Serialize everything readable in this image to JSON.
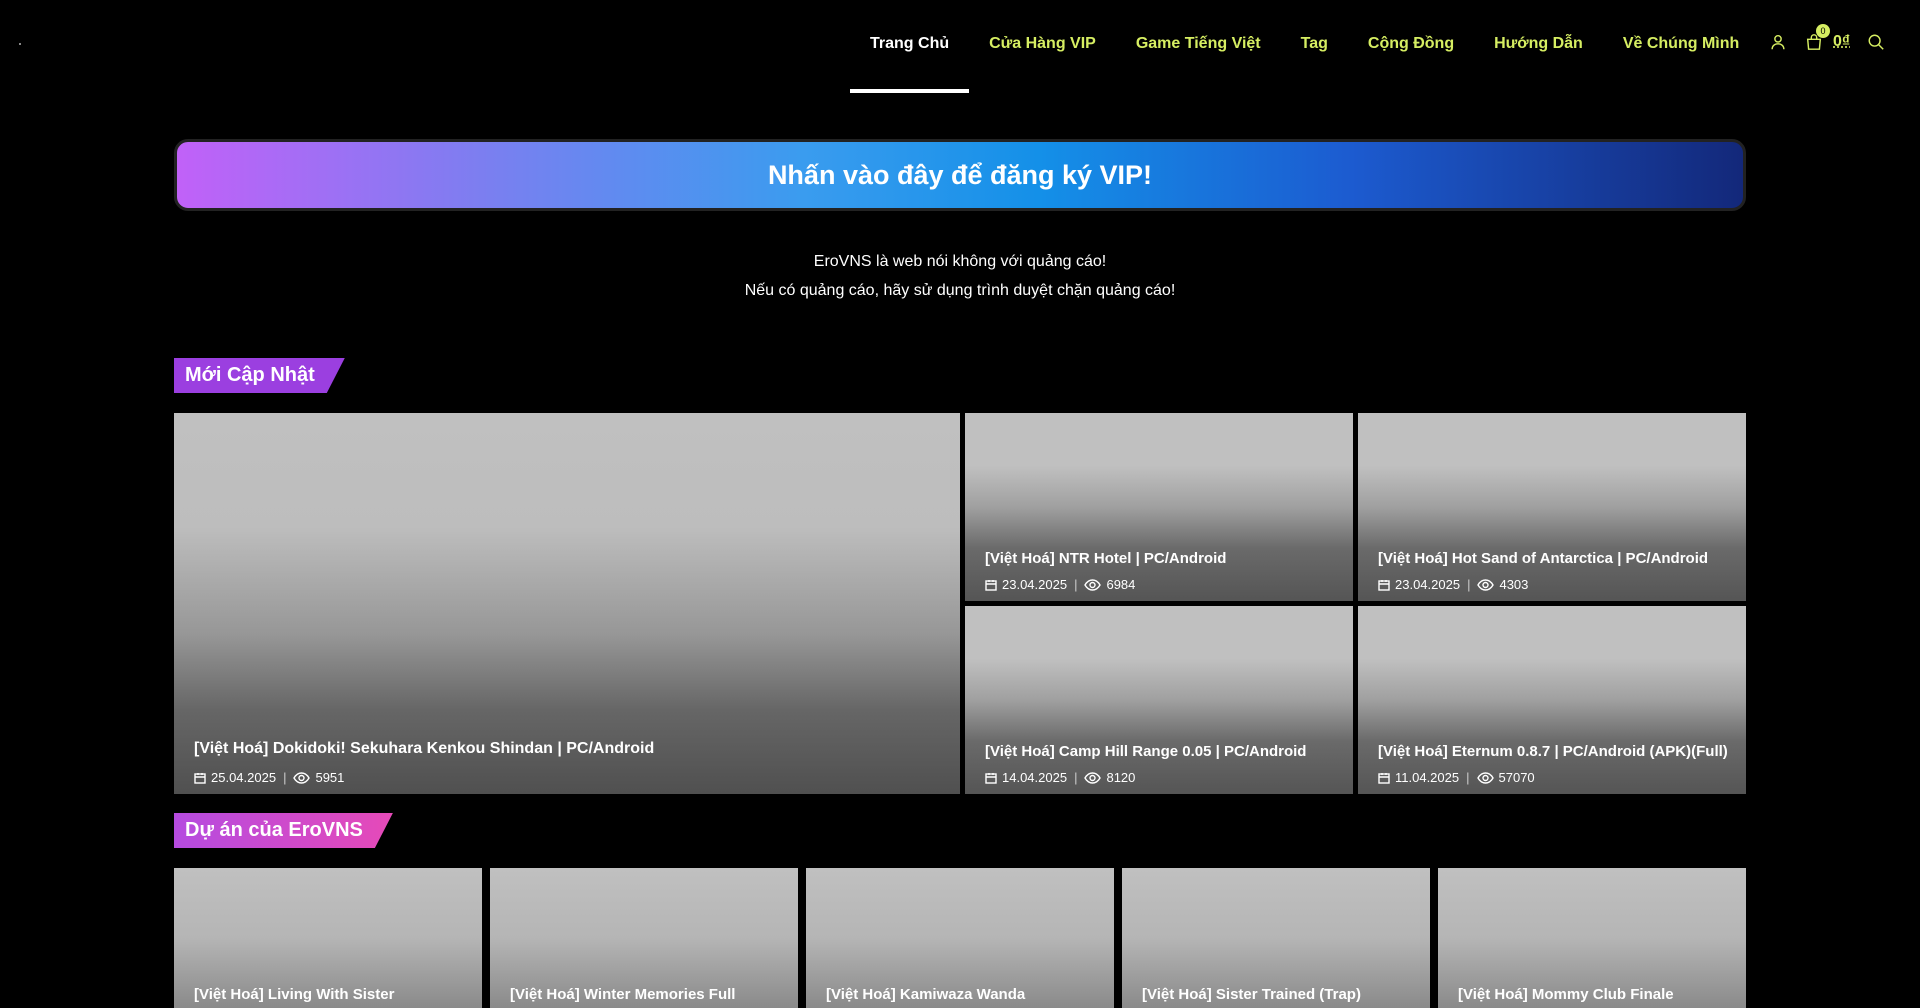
{
  "nav": {
    "items": [
      {
        "label": "Trang Chủ",
        "active": true
      },
      {
        "label": "Cửa Hàng VIP"
      },
      {
        "label": "Game Tiếng Việt"
      },
      {
        "label": "Tag"
      },
      {
        "label": "Cộng Đồng"
      },
      {
        "label": "Hướng Dẫn"
      },
      {
        "label": "Về Chúng Mình"
      }
    ],
    "cart_count": "0",
    "cart_total": "0₫"
  },
  "banner": {
    "text": "Nhấn vào đây để đăng ký VIP!"
  },
  "notice": {
    "line1": "EroVNS là web nói không với quảng cáo!",
    "line2": "Nếu có quảng cáo, hãy sử dụng trình duyệt chặn quảng cáo!"
  },
  "latest": {
    "title": "Mới Cập Nhật",
    "posts": [
      {
        "title": "[Việt Hoá] Dokidoki! Sekuhara Kenkou Shindan | PC/Android",
        "date": "25.04.2025",
        "views": "5951"
      },
      {
        "title": "[Việt Hoá] NTR Hotel | PC/Android",
        "date": "23.04.2025",
        "views": "6984"
      },
      {
        "title": "[Việt Hoá] Hot Sand of Antarctica | PC/Android",
        "date": "23.04.2025",
        "views": "4303"
      },
      {
        "title": "[Việt Hoá] Camp Hill Range 0.05 | PC/Android",
        "date": "14.04.2025",
        "views": "8120"
      },
      {
        "title": "[Việt Hoá] Eternum 0.8.7 | PC/Android (APK)(Full)",
        "date": "11.04.2025",
        "views": "57070"
      }
    ]
  },
  "projects": {
    "title": "Dự án của EroVNS",
    "posts": [
      {
        "title": "[Việt Hoá] Living With Sister"
      },
      {
        "title": "[Việt Hoá] Winter Memories Full"
      },
      {
        "title": "[Việt Hoá] Kamiwaza Wanda"
      },
      {
        "title": "[Việt Hoá] Sister Trained (Trap)"
      },
      {
        "title": "[Việt Hoá] Mommy Club Finale"
      }
    ]
  }
}
